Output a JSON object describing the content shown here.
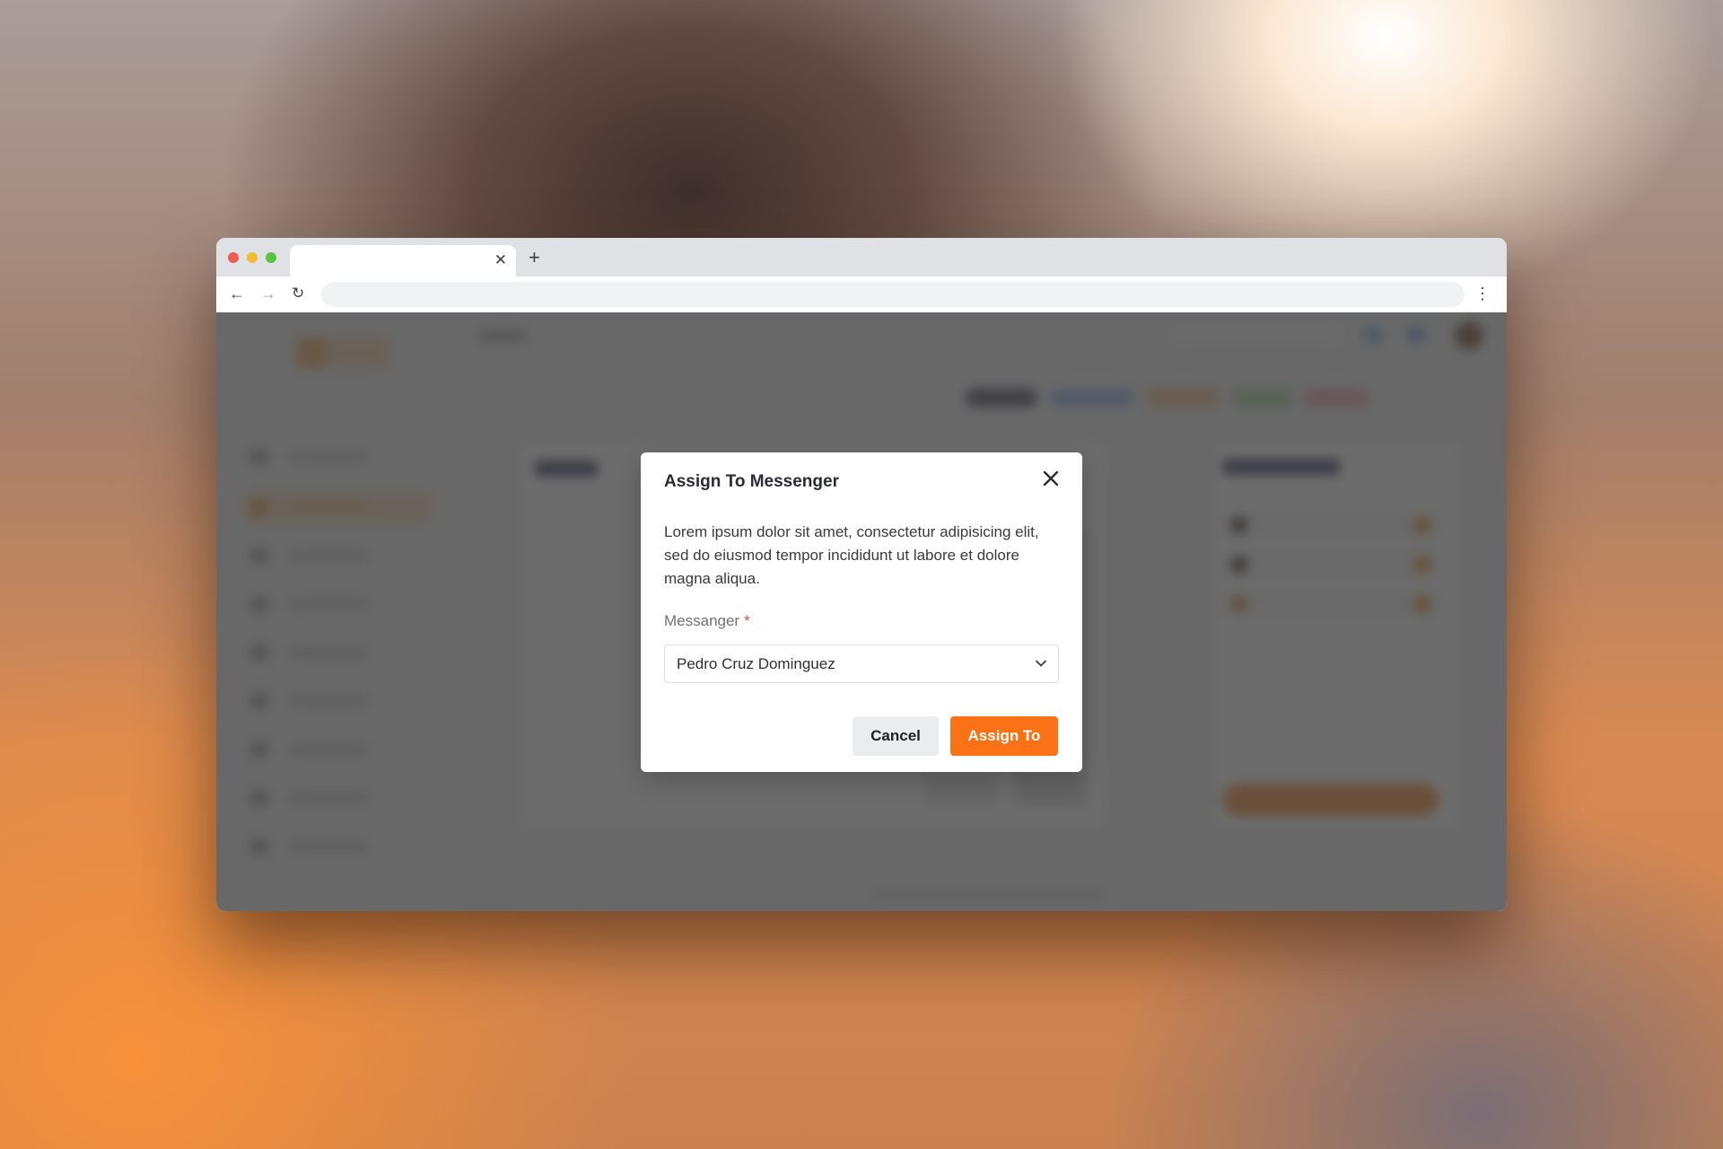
{
  "browser": {
    "tab_title": "",
    "url": "",
    "icons": {
      "back": "arrow-left-icon",
      "forward": "arrow-right-icon",
      "reload": "reload-icon",
      "tab_close": "close-icon",
      "new_tab": "plus-icon",
      "menu": "kebab-menu-icon"
    }
  },
  "modal": {
    "title": "Assign To Messenger",
    "description": "Lorem ipsum dolor sit amet, consectetur adipisicing elit, sed do eiusmod tempor incididunt ut labore et dolore magna aliqua.",
    "field_label": "Messanger",
    "required_mark": "*",
    "selected_value": "Pedro Cruz Dominguez",
    "cancel_label": "Cancel",
    "assign_label": "Assign To"
  },
  "colors": {
    "accent": "#f97316",
    "required": "#e24c4c",
    "overlay": "rgba(66,66,66,0.78)"
  }
}
